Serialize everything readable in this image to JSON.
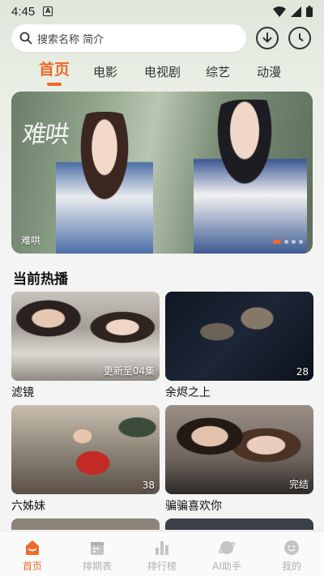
{
  "status_bar": {
    "time": "4:45",
    "notification_icon": "a-badge-icon",
    "icons": [
      "wifi-icon",
      "signal-icon",
      "battery-icon"
    ]
  },
  "search": {
    "placeholder": "搜索名称 简介",
    "icons": [
      "search-icon",
      "download-icon",
      "history-icon"
    ]
  },
  "tabs": [
    {
      "label": "首页",
      "active": true
    },
    {
      "label": "电影",
      "active": false
    },
    {
      "label": "电视剧",
      "active": false
    },
    {
      "label": "综艺",
      "active": false
    },
    {
      "label": "动漫",
      "active": false
    }
  ],
  "banner": {
    "calligraphy": "难哄",
    "title": "难哄",
    "page_count": 4,
    "active_page": 1
  },
  "section": {
    "title": "当前热播"
  },
  "cards": [
    {
      "title": "滤镜",
      "badge": "更新至04集"
    },
    {
      "title": "余烬之上",
      "badge": "28"
    },
    {
      "title": "六姊妹",
      "badge": "38"
    },
    {
      "title": "骗骗喜欢你",
      "badge": "完结"
    }
  ],
  "bottom_nav": [
    {
      "label": "首页",
      "icon": "home-icon",
      "active": true
    },
    {
      "label": "排期表",
      "icon": "calendar-icon",
      "active": false
    },
    {
      "label": "排行榜",
      "icon": "ranking-icon",
      "active": false
    },
    {
      "label": "AI助手",
      "icon": "ai-assistant-icon",
      "active": false
    },
    {
      "label": "我的",
      "icon": "profile-icon",
      "active": false
    }
  ],
  "colors": {
    "accent": "#ef6a2a",
    "inactive": "#b0b0b0",
    "background": "#f4f4f4"
  }
}
